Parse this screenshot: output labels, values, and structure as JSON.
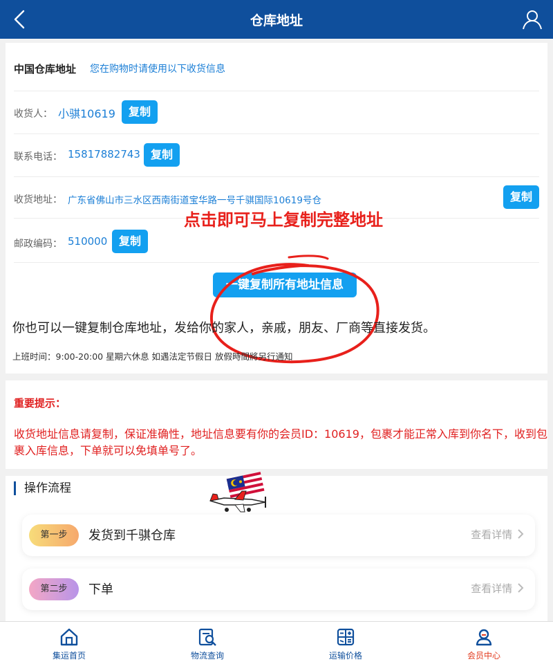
{
  "header": {
    "title": "仓库地址",
    "back_icon": "back-chevron-icon",
    "user_icon": "user-icon"
  },
  "warehouse": {
    "heading": "中国仓库地址",
    "hint": "您在购物时请使用以下收货信息",
    "recipient_label": "收货人：",
    "recipient_value": "小骐10619",
    "phone_label": "联系电话：",
    "phone_value": "15817882743",
    "address_label": "收货地址：",
    "address_value": "广东省佛山市三水区西南街道宝华路一号千骐国际10619号仓",
    "postcode_label": "邮政编码：",
    "postcode_value": "510000",
    "copy_label": "复制",
    "copy_all_label": "一键复制所有地址信息",
    "annotation": "点击即可马上复制完整地址",
    "description": "你也可以一键复制仓库地址，发给你的家人，亲戚，朋友、厂商等直接发货。",
    "hours": "上班时间：9:00-20:00 星期六休息 如遇法定节假日 放假時間將另行通知"
  },
  "notice": {
    "title": "重要提示：",
    "body": "收货地址信息请复制，保证准确性，地址信息要有你的会员ID：10619，包裹才能正常入库到你名下，收到包裹入库信息，下单就可以免填单号了。"
  },
  "process": {
    "title": "操作流程",
    "steps": [
      {
        "badge": "第一步",
        "title": "发货到千骐仓库",
        "more": "查看详情"
      },
      {
        "badge": "第二步",
        "title": "下单",
        "more": "查看详情"
      }
    ]
  },
  "tabbar": [
    {
      "label": "集运首页",
      "icon": "home-icon"
    },
    {
      "label": "物流查询",
      "icon": "logistics-search-icon"
    },
    {
      "label": "运输价格",
      "icon": "calculator-icon"
    },
    {
      "label": "会员中心",
      "icon": "member-icon",
      "active": true
    }
  ],
  "colors": {
    "header": "#0f4f9c",
    "button": "#13a0f0",
    "link": "#1c7fd6",
    "alert": "#e02020",
    "annotation": "#e8201b",
    "active_tab": "#e23b1f"
  }
}
